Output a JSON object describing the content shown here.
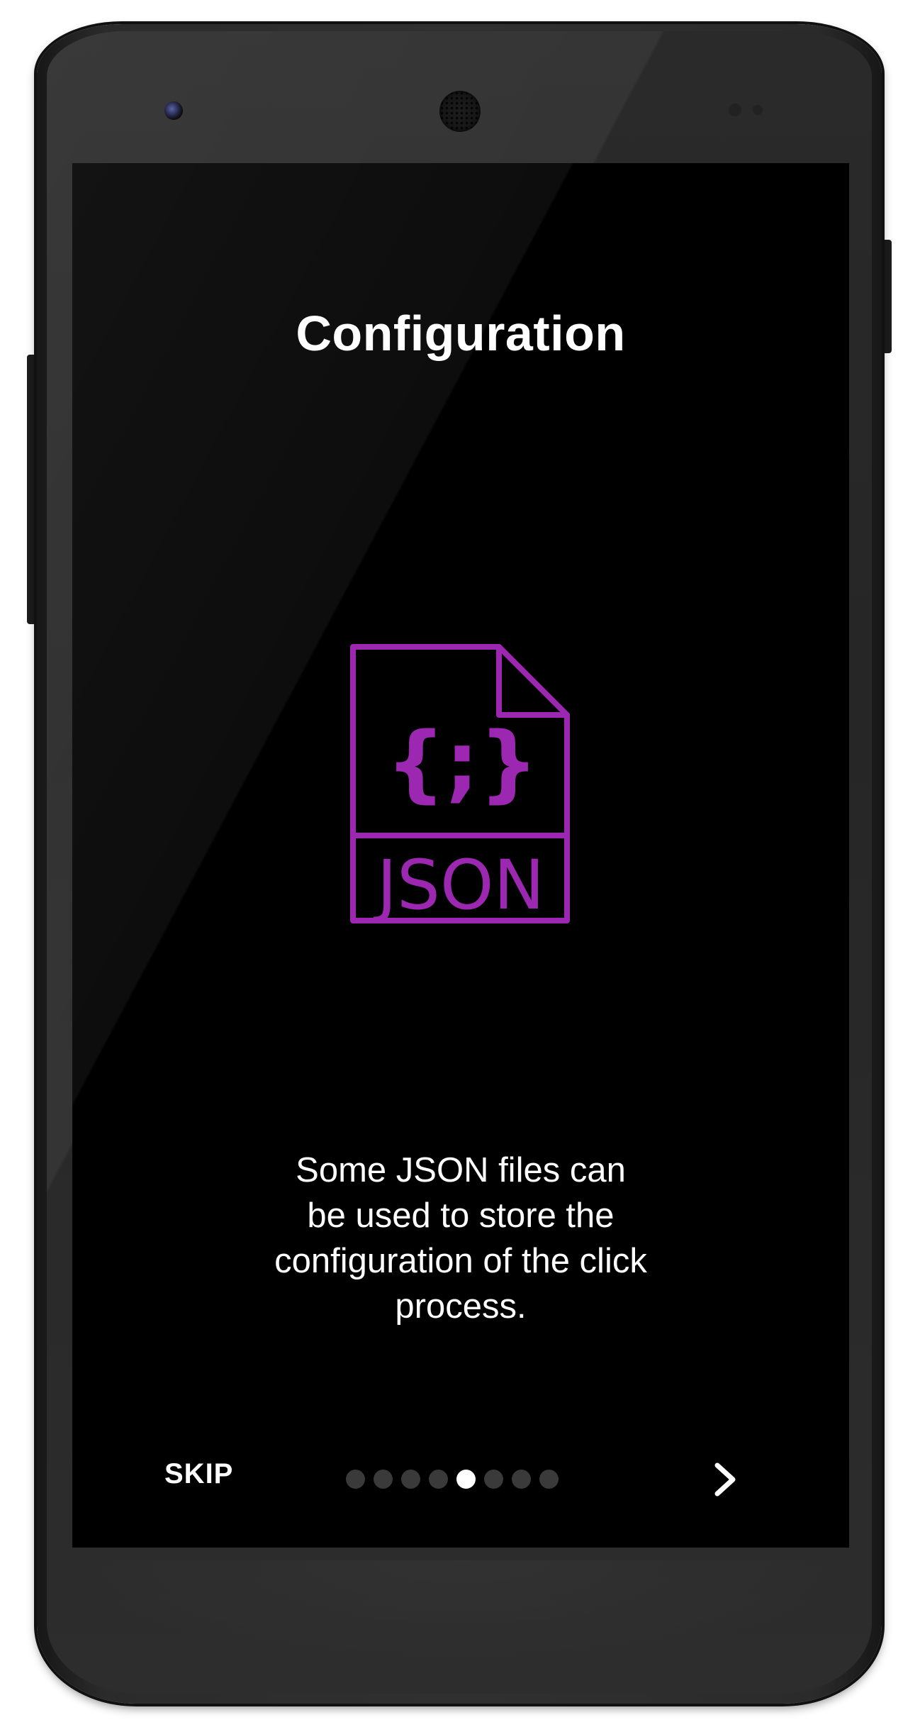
{
  "onboarding": {
    "title": "Configuration",
    "description_lines": [
      "Some JSON files can",
      "be used to store the",
      "configuration of the click",
      "process."
    ],
    "illustration": {
      "icon": "json-file-icon",
      "braces_text": "{;}",
      "label": "JSON",
      "color": "#9c27b0"
    },
    "footer": {
      "skip_label": "SKIP",
      "next_icon": "chevron-right-icon",
      "page_count": 8,
      "current_page": 5
    }
  },
  "colors": {
    "screen_background": "#000000",
    "text": "#ffffff",
    "dot_inactive": "#3a3a3a",
    "dot_active": "#ffffff",
    "accent": "#9c27b0"
  }
}
